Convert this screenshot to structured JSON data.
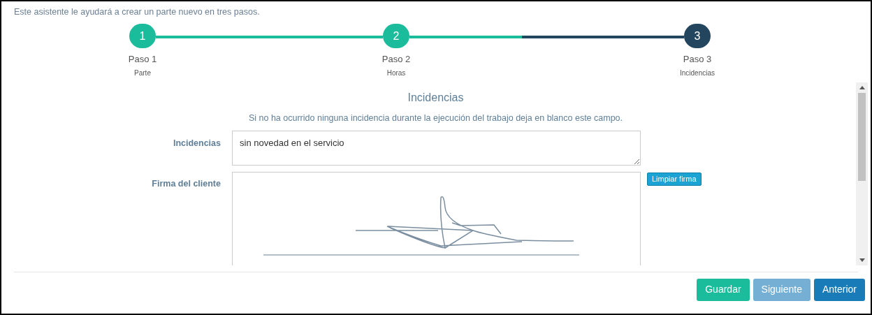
{
  "intro": "Este asistente le ayudará a crear un parte nuevo en tres pasos.",
  "stepper": {
    "level": 0.41,
    "steps": [
      {
        "number": "1",
        "label": "Paso 1",
        "sublabel": "Parte",
        "completed": true
      },
      {
        "number": "2",
        "label": "Paso 2",
        "sublabel": "Horas",
        "completed": true
      },
      {
        "number": "3",
        "label": "Paso 3",
        "sublabel": "Incidencias",
        "completed": false
      }
    ]
  },
  "section": {
    "title": "Incidencias",
    "hint": "Si no ha ocurrido ninguna incidencia durante la ejecución del trabajo deja en blanco este campo.",
    "incidents": {
      "label": "Incidencias",
      "value": "sin novedad en el servicio"
    },
    "signature": {
      "label": "Firma del cliente",
      "clear_button": "Limpiar firma"
    }
  },
  "buttons": [
    {
      "label": "Guardar",
      "kind": "save",
      "disabled": false
    },
    {
      "label": "Siguiente",
      "kind": "next",
      "disabled": true
    },
    {
      "label": "Anterior",
      "kind": "prev",
      "disabled": false
    }
  ]
}
